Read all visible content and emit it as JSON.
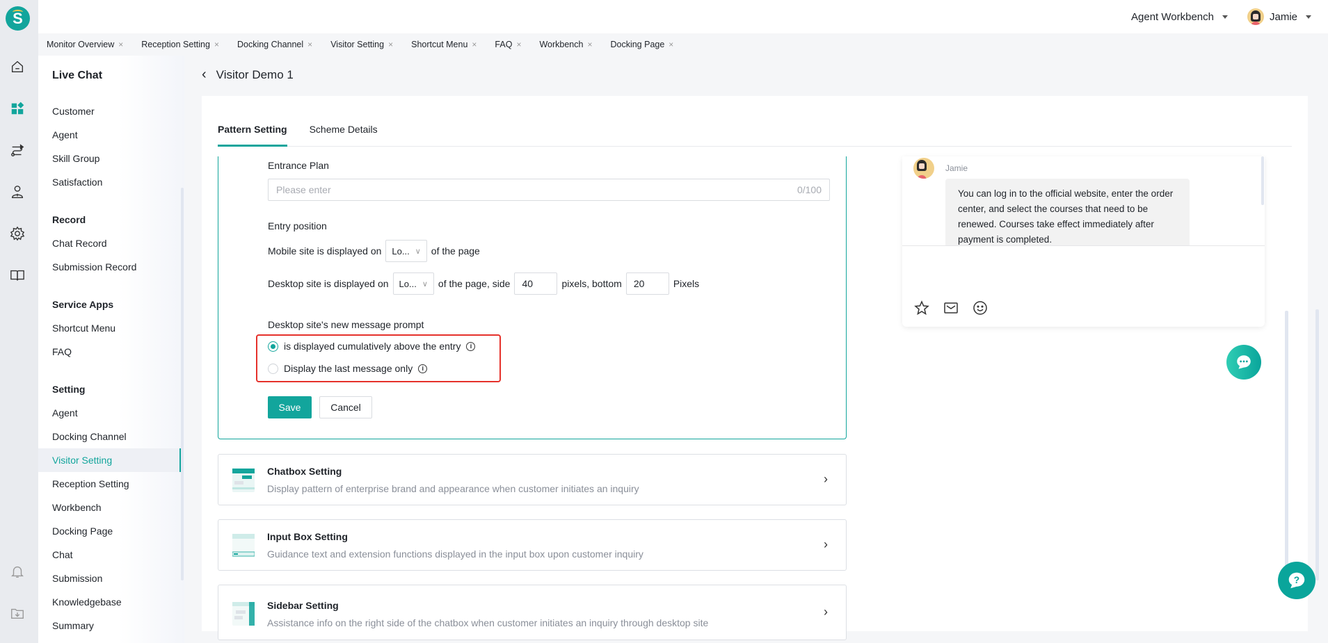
{
  "rail": {
    "icons": [
      "logo-icon",
      "home-icon",
      "dashboard-icon",
      "route-icon",
      "agent-icon",
      "settings-icon",
      "book-icon",
      "bell-icon",
      "download-folder-icon"
    ],
    "logo_letter": "S",
    "active_color": "#12a59c"
  },
  "header": {
    "workbench_label": "Agent Workbench",
    "user_name": "Jamie"
  },
  "open_tabs": [
    {
      "label": "Monitor Overview"
    },
    {
      "label": "Reception Setting"
    },
    {
      "label": "Docking Channel"
    },
    {
      "label": "Visitor Setting"
    },
    {
      "label": "Shortcut Menu"
    },
    {
      "label": "FAQ"
    },
    {
      "label": "Workbench"
    },
    {
      "label": "Docking Page"
    }
  ],
  "close_glyph": "×",
  "sidebar": {
    "title": "Live Chat",
    "items": [
      {
        "label": "Customer"
      },
      {
        "label": "Agent"
      },
      {
        "label": "Skill Group"
      },
      {
        "label": "Satisfaction"
      }
    ],
    "groups": [
      {
        "label": "Record",
        "items": [
          {
            "label": "Chat Record"
          },
          {
            "label": "Submission Record"
          }
        ]
      },
      {
        "label": "Service Apps",
        "items": [
          {
            "label": "Shortcut Menu"
          },
          {
            "label": "FAQ"
          }
        ]
      },
      {
        "label": "Setting",
        "items": [
          {
            "label": "Agent"
          },
          {
            "label": "Docking Channel"
          },
          {
            "label": "Visitor Setting",
            "active": true
          },
          {
            "label": "Reception Setting"
          },
          {
            "label": "Workbench"
          },
          {
            "label": "Docking Page"
          },
          {
            "label": "Chat"
          },
          {
            "label": "Submission"
          },
          {
            "label": "Knowledgebase"
          },
          {
            "label": "Summary"
          }
        ]
      }
    ]
  },
  "page": {
    "title": "Visitor Demo 1",
    "tabs": [
      {
        "label": "Pattern Setting",
        "active": true
      },
      {
        "label": "Scheme Details"
      }
    ]
  },
  "form": {
    "entrance_plan_label": "Entrance Plan",
    "entrance_plan_placeholder": "Please enter",
    "entrance_plan_value": "",
    "entrance_plan_counter": "0/100",
    "entry_position_label": "Entry position",
    "mobile_prefix": "Mobile site is displayed on",
    "mobile_select": "Lo...",
    "mobile_suffix": "of the page",
    "desktop_prefix": "Desktop site is displayed on",
    "desktop_select": "Lo...",
    "desktop_mid": "of the page, side",
    "side_value": "40",
    "pixels_bottom": "pixels, bottom",
    "bottom_value": "20",
    "pixels_suffix": "Pixels",
    "prompt_label": "Desktop site's new message prompt",
    "radio_options": [
      {
        "label": "is displayed cumulatively above the entry",
        "checked": true
      },
      {
        "label": "Display the last message only",
        "checked": false
      }
    ],
    "save_label": "Save",
    "cancel_label": "Cancel"
  },
  "cards": [
    {
      "title": "Chatbox Setting",
      "desc": "Display pattern of enterprise brand and appearance when customer initiates an inquiry"
    },
    {
      "title": "Input Box Setting",
      "desc": "Guidance text and extension functions displayed in the input box upon customer inquiry"
    },
    {
      "title": "Sidebar Setting",
      "desc": "Assistance info on the right side of the chatbox when customer initiates an inquiry through desktop site"
    }
  ],
  "chat_preview": {
    "sender": "Jamie",
    "message": "You can log in to the official website, enter the order center, and select the courses that need to be renewed. Courses take effect immediately after payment is completed.",
    "tools": [
      "star-icon",
      "mail-icon",
      "emoji-icon"
    ]
  },
  "colors": {
    "brand": "#12a59c",
    "highlight_box": "#e5312b"
  }
}
